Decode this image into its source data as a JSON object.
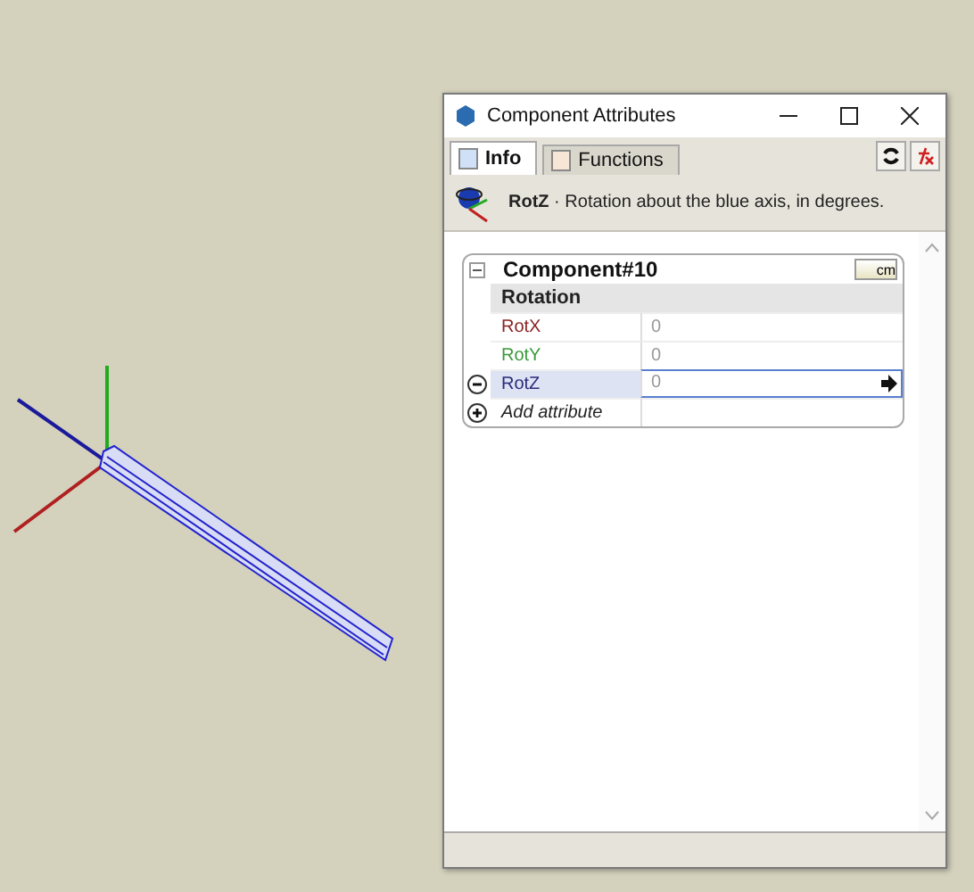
{
  "window": {
    "title": "Component Attributes"
  },
  "tabs": [
    {
      "label": "Info",
      "selected": true
    },
    {
      "label": "Functions",
      "selected": false
    }
  ],
  "info": {
    "text": "**RotZ** · Rotation about the blue axis, in degrees."
  },
  "component": {
    "title": "Component#10",
    "expanded": true,
    "unit": "cm",
    "group": "Rotation",
    "add_label": "Add attribute",
    "attributes": [
      {
        "name": "RotX",
        "value": "0",
        "color": "#8b2323",
        "selected": false
      },
      {
        "name": "RotY",
        "value": "0",
        "color": "#3a9a3a",
        "selected": false
      },
      {
        "name": "RotZ",
        "value": "0",
        "color": "#2a2a7a",
        "selected": true
      }
    ]
  }
}
